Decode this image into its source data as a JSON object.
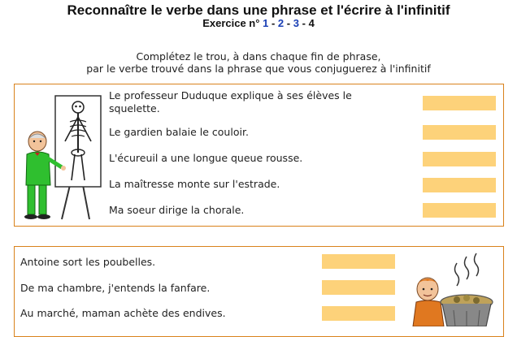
{
  "header": {
    "title": "Reconnaître le verbe dans une phrase et l'écrire à l'infinitif",
    "exercise_label": "Exercice n°",
    "exercise_links": [
      "1",
      "2",
      "3"
    ],
    "separator": "-",
    "current_exercise": "4"
  },
  "instructions": {
    "line1": "Complétez le trou, à dans chaque fin de phrase,",
    "line2": "par le verbe trouvé dans la phrase que vous conjuguerez à l'infinitif"
  },
  "group1": {
    "illustration": "teacher-skeleton-icon",
    "sentences": [
      {
        "line1": "Le professeur Duduque explique à ses élèves le",
        "line2": "squelette.",
        "value": ""
      },
      {
        "text": "Le gardien balaie le couloir.",
        "value": ""
      },
      {
        "text": "L'écureuil a une longue queue rousse.",
        "value": ""
      },
      {
        "text": "La maîtresse monte sur l'estrade.",
        "value": ""
      },
      {
        "text": "Ma soeur dirige la chorale.",
        "value": ""
      }
    ]
  },
  "group2": {
    "illustration": "boy-trash-can-icon",
    "sentences": [
      {
        "text": "Antoine sort les poubelles.",
        "value": ""
      },
      {
        "text": "De ma chambre, j'entends la fanfare.",
        "value": ""
      },
      {
        "text": "Au marché, maman achète des endives.",
        "value": ""
      }
    ]
  },
  "colors": {
    "border": "#d9821c",
    "answer_field": "#fdd27a",
    "link": "#1a3fb5"
  }
}
